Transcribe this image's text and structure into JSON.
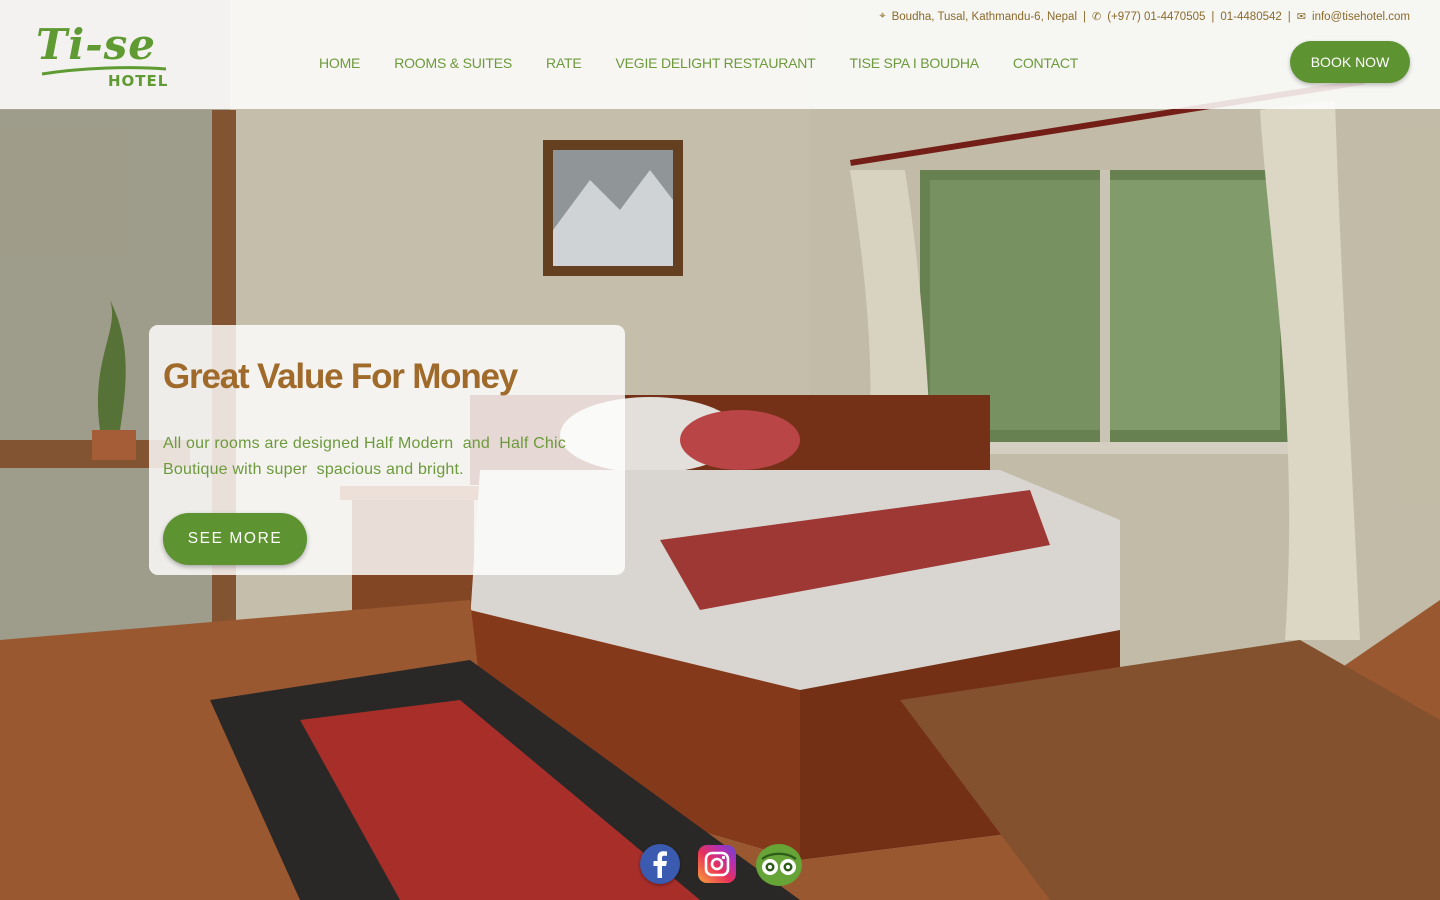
{
  "brand": {
    "logo_script": "Ti-se",
    "logo_sub": "HOTEL",
    "primary_color": "#5e9331",
    "accent_color": "#a06a2a"
  },
  "topbar": {
    "address_icon": "map-marker-icon",
    "address": "Boudha, Tusal, Kathmandu-6, Nepal",
    "phone_icon": "phone-icon",
    "phone": "(+977) 01-4470505",
    "phone2": "01-4480542",
    "email_icon": "envelope-icon",
    "email": "info@tisehotel.com"
  },
  "nav": {
    "items": [
      {
        "label": "HOME"
      },
      {
        "label": "ROOMS & SUITES"
      },
      {
        "label": "RATE"
      },
      {
        "label": "VEGIE DELIGHT RESTAURANT"
      },
      {
        "label": "TISE SPA I BOUDHA"
      },
      {
        "label": "CONTACT"
      }
    ],
    "book_label": "BOOK NOW"
  },
  "hero": {
    "title": "Great Value For Money",
    "text": "All our rooms are designed Half Modern  and  Half Chic Boutique with super  spacious and bright.",
    "button_label": "SEE MORE"
  },
  "socials": [
    {
      "name": "facebook",
      "icon": "facebook-icon"
    },
    {
      "name": "instagram",
      "icon": "instagram-icon"
    },
    {
      "name": "tripadvisor",
      "icon": "tripadvisor-icon"
    }
  ]
}
